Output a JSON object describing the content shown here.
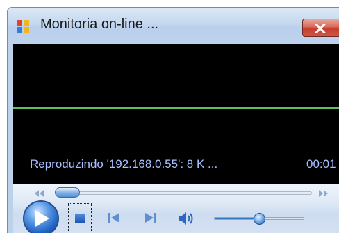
{
  "window": {
    "title": "Monitoria on-line ..."
  },
  "player": {
    "status_text": "Reproduzindo '192.168.0.55': 8 K ...",
    "time_text": "00:01",
    "seek_position": 0.05,
    "volume_level": 0.52
  },
  "icons": {
    "app": "app-icon",
    "close": "close-icon",
    "rewind": "rewind-icon",
    "fast_forward": "fast-forward-icon",
    "play": "play-icon",
    "stop": "stop-icon",
    "previous": "previous-icon",
    "next": "next-icon",
    "volume": "speaker-icon"
  },
  "colors": {
    "status_text": "#a8c0ff",
    "graph_line": "#60c060",
    "close_button": "#c4402f",
    "video_background": "#000000"
  }
}
